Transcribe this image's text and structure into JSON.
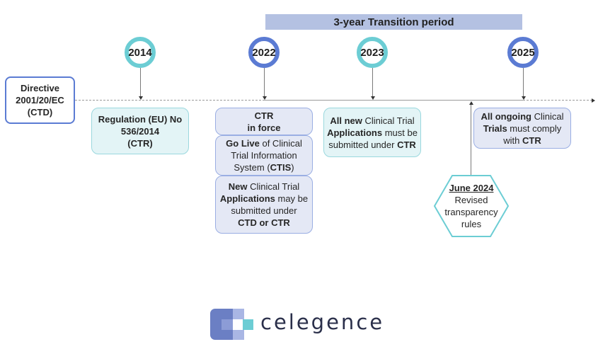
{
  "banner": {
    "label": "3-year Transition period"
  },
  "milestones": [
    {
      "year": "2014",
      "style": "teal"
    },
    {
      "year": "2022",
      "style": "blue"
    },
    {
      "year": "2023",
      "style": "teal"
    },
    {
      "year": "2025",
      "style": "blue"
    }
  ],
  "start_box": {
    "lines": [
      "Directive",
      "2001/20/EC",
      "(CTD)"
    ]
  },
  "boxes": {
    "b2014": {
      "line1": "Regulation (EU) No",
      "line2": "536/2014",
      "line3": "(CTR)"
    },
    "b2022a": {
      "line1": "CTR",
      "line2": "in force"
    },
    "b2022b": {
      "bold1": "Go Live",
      "text1": " of Clinical",
      "line2": "Trial Information",
      "text3a": "System (",
      "bold3": "CTIS",
      "text3b": ")"
    },
    "b2022c": {
      "bold1": "New",
      "text1": " Clinical Trial",
      "bold2": "Applications",
      "text2": " may be",
      "line3": "submitted under",
      "bold4": "CTD or CTR"
    },
    "b2023": {
      "bold1": "All new",
      "text1": " Clinical Trial",
      "bold2": "Applications",
      "text2": " must be",
      "text3": "submitted under ",
      "bold3": "CTR"
    },
    "b2025": {
      "bold1": "All ongoing",
      "text1": " Clinical",
      "bold2": "Trials",
      "text2": " must comply",
      "text3": "with ",
      "bold3": "CTR"
    }
  },
  "hexagon": {
    "title": "June 2024",
    "line1": "Revised",
    "line2": "transparency",
    "line3": "rules"
  },
  "logo": {
    "text": "celegence",
    "colors": {
      "dark": "#6b7fc4",
      "mid": "#8c9cd6",
      "light": "#a9b6e4",
      "teal": "#6ccdd4"
    }
  },
  "colors": {
    "teal": "#6ccdd4",
    "blue": "#5b7bd3",
    "banner": "#b4c1e2"
  }
}
